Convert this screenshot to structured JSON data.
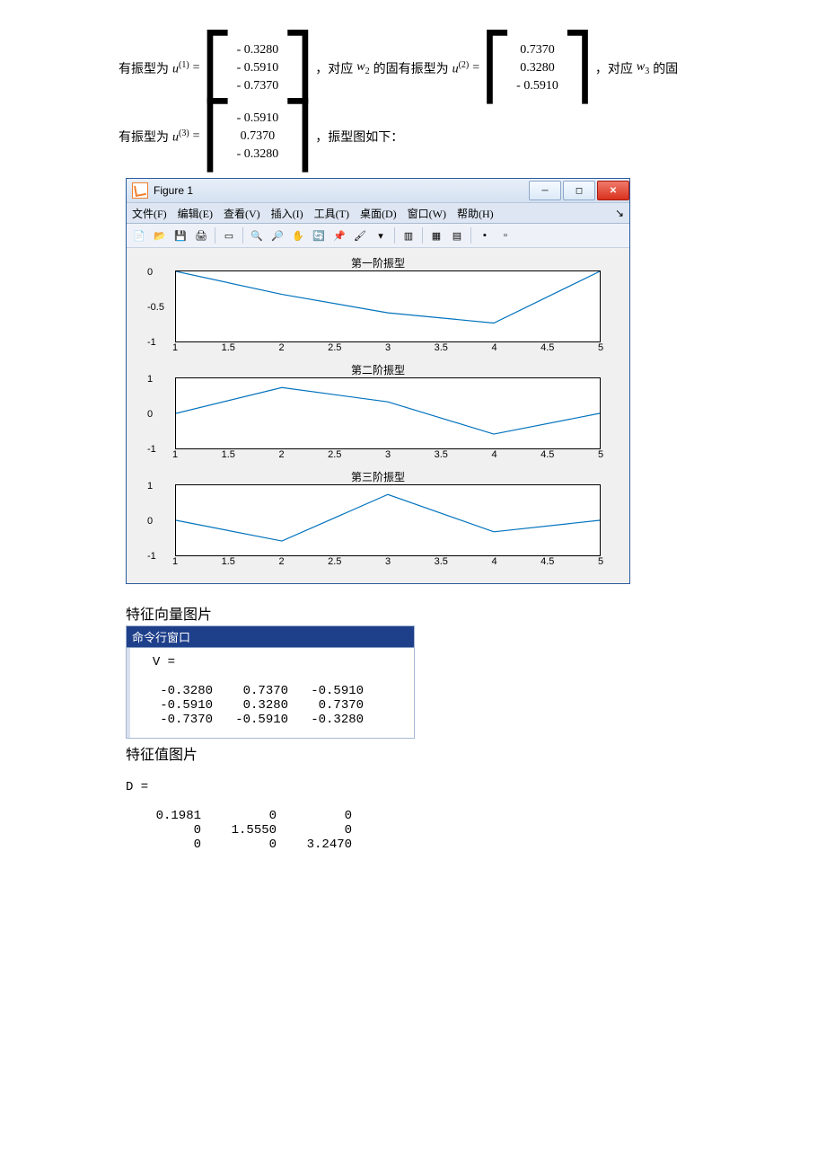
{
  "text": {
    "intro1a": "有振型为",
    "u1": "u",
    "sup1": "(1)",
    "eq": " = ",
    "intro1b": "，对应",
    "w2": "w",
    "w2s": "2",
    "intro1c": "的固有振型为",
    "sup2": "(2)",
    "intro1d": "，对应",
    "w3": "w",
    "w3s": "3",
    "intro1e": "的固",
    "intro2a": "有振型为",
    "sup3": "(3)",
    "intro2b": "，振型图如下："
  },
  "vectors": {
    "u1": [
      "- 0.3280",
      "- 0.5910",
      "- 0.7370"
    ],
    "u2": [
      "0.7370",
      "0.3280",
      "- 0.5910"
    ],
    "u3": [
      "- 0.5910",
      "0.7370",
      "- 0.3280"
    ]
  },
  "figure": {
    "title": "Figure 1",
    "menu": [
      "文件(F)",
      "编辑(E)",
      "查看(V)",
      "插入(I)",
      "工具(T)",
      "桌面(D)",
      "窗口(W)",
      "帮助(H)"
    ],
    "subplots": [
      {
        "title": "第一阶振型",
        "ylim": [
          -1,
          0
        ],
        "yticks": [
          "0",
          "-0.5",
          "-1"
        ]
      },
      {
        "title": "第二阶振型",
        "ylim": [
          -1,
          1
        ],
        "yticks": [
          "1",
          "0",
          "-1"
        ]
      },
      {
        "title": "第三阶振型",
        "ylim": [
          -1,
          1
        ],
        "yticks": [
          "1",
          "0",
          "-1"
        ]
      }
    ],
    "xticks": [
      "1",
      "1.5",
      "2",
      "2.5",
      "3",
      "3.5",
      "4",
      "4.5",
      "5"
    ]
  },
  "chart_data": [
    {
      "type": "line",
      "title": "第一阶振型",
      "x": [
        1,
        2,
        3,
        4,
        5
      ],
      "y": [
        0,
        -0.328,
        -0.591,
        -0.737,
        0
      ],
      "xlim": [
        1,
        5
      ],
      "ylim": [
        -1,
        0
      ],
      "xlabel": "",
      "ylabel": ""
    },
    {
      "type": "line",
      "title": "第二阶振型",
      "x": [
        1,
        2,
        3,
        4,
        5
      ],
      "y": [
        0,
        0.737,
        0.328,
        -0.591,
        0
      ],
      "xlim": [
        1,
        5
      ],
      "ylim": [
        -1,
        1
      ],
      "xlabel": "",
      "ylabel": ""
    },
    {
      "type": "line",
      "title": "第三阶振型",
      "x": [
        1,
        2,
        3,
        4,
        5
      ],
      "y": [
        0,
        -0.591,
        0.737,
        -0.328,
        0
      ],
      "xlim": [
        1,
        5
      ],
      "ylim": [
        -1,
        1
      ],
      "xlabel": "",
      "ylabel": ""
    }
  ],
  "captions": {
    "eigvec": "特征向量图片",
    "eigval": "特征值图片",
    "cmdtitle": "命令行窗口"
  },
  "cmd_V": {
    "label": "V =",
    "rows": [
      "   -0.3280    0.7370   -0.5910",
      "   -0.5910    0.3280    0.7370",
      "   -0.7370   -0.5910   -0.3280"
    ]
  },
  "cmd_D": {
    "label": "D =",
    "rows": [
      "    0.1981         0         0",
      "         0    1.5550         0",
      "         0         0    3.2470"
    ]
  }
}
